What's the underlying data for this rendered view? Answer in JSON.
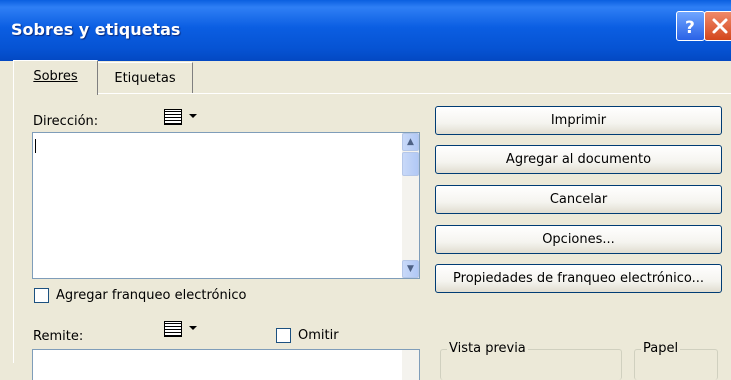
{
  "window": {
    "title": "Sobres y etiquetas"
  },
  "tabs": [
    {
      "label": "Sobres"
    },
    {
      "label": "Etiquetas"
    }
  ],
  "direccion": {
    "label": "Dirección:",
    "value": ""
  },
  "franqueo_checkbox": {
    "label": "Agregar franqueo electrónico",
    "checked": false
  },
  "remite": {
    "label": "Remite:",
    "omitir_label": "Omitir",
    "omitir_checked": false
  },
  "buttons": {
    "imprimir": "Imprimir",
    "agregar": "Agregar al documento",
    "cancelar": "Cancelar",
    "opciones": "Opciones...",
    "propiedades": "Propiedades de franqueo electrónico..."
  },
  "groups": {
    "vista_previa": "Vista previa",
    "papel": "Papel"
  },
  "icons": {
    "help": "help-icon",
    "close": "close-icon",
    "address_book": "address-book-icon",
    "scroll_up": "scroll-up-icon",
    "scroll_down": "scroll-down-icon"
  }
}
